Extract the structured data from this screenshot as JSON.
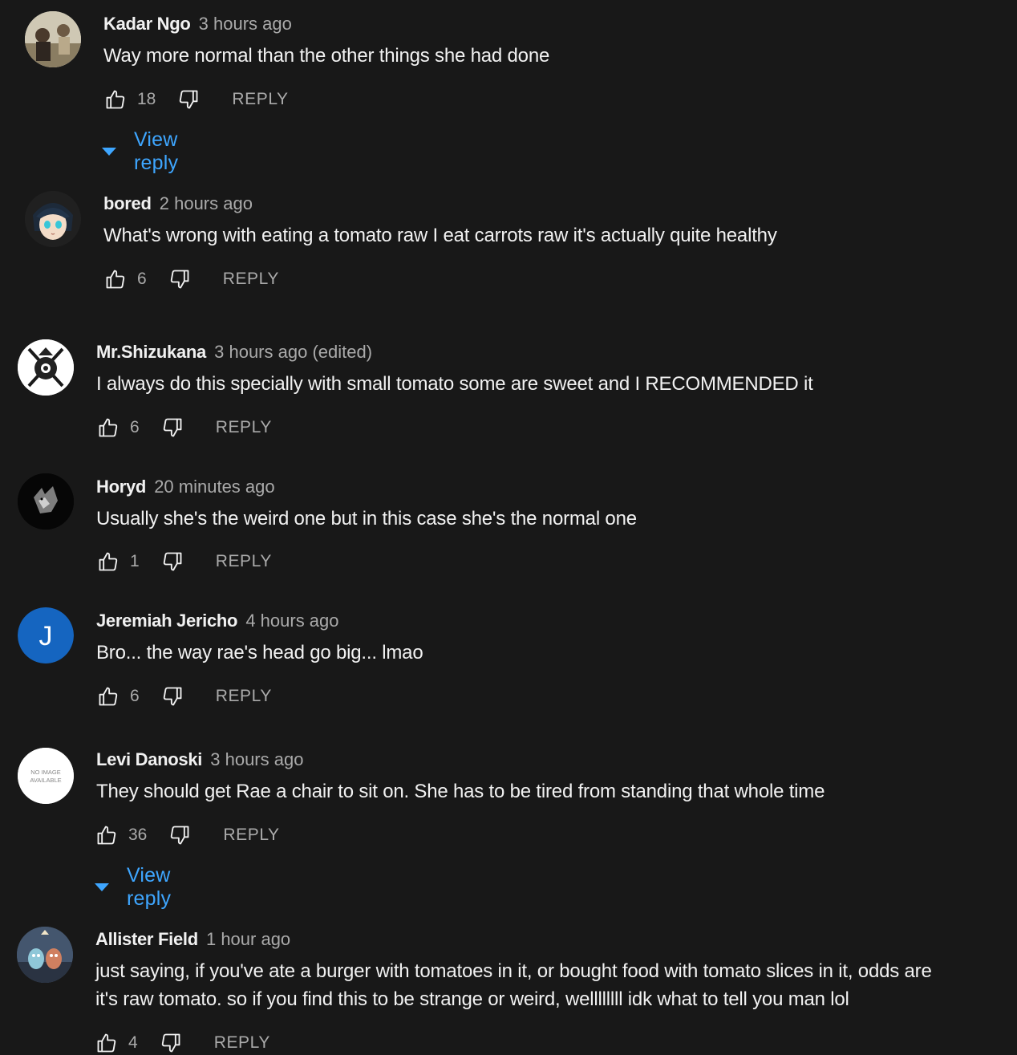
{
  "comments": [
    {
      "author": "Kadar Ngo",
      "time": "3 hours ago",
      "edited": "",
      "text": "Way more normal than the other things she had done",
      "likes": "18",
      "reply_label": "REPLY",
      "view_reply_label": "View reply",
      "avatar_type": "photo-person"
    },
    {
      "author": "bored",
      "time": "2 hours ago",
      "edited": "",
      "text": "What's wrong with eating a tomato raw I eat carrots raw it's actually quite healthy",
      "likes": "6",
      "reply_label": "REPLY",
      "avatar_type": "anime-character"
    },
    {
      "author": "Mr.Shizukana",
      "time": "3 hours ago",
      "edited": "(edited)",
      "text": "I always do this specially with small tomato some are sweet and I RECOMMENDED it",
      "likes": "6",
      "reply_label": "REPLY",
      "avatar_type": "crossed-swords-emblem"
    },
    {
      "author": "Horyd",
      "time": "20 minutes ago",
      "edited": "",
      "text": "Usually she's the weird one but in this case she's the normal one",
      "likes": "1",
      "reply_label": "REPLY",
      "avatar_type": "dark-wolf"
    },
    {
      "author": "Jeremiah Jericho",
      "time": "4 hours ago",
      "edited": "",
      "text": "Bro... the way rae's head go big... lmao",
      "likes": "6",
      "reply_label": "REPLY",
      "avatar_letter": "J",
      "avatar_color": "#1565c0",
      "avatar_type": "letter"
    },
    {
      "author": "Levi Danoski",
      "time": "3 hours ago",
      "edited": "",
      "text": "They should get Rae a chair to sit on. She has to be tired from standing that whole time",
      "likes": "36",
      "reply_label": "REPLY",
      "view_reply_label": "View reply",
      "avatar_placeholder": "NO IMAGE AVAILABLE",
      "avatar_type": "no-image"
    },
    {
      "author": "Allister Field",
      "time": "1 hour ago",
      "edited": "",
      "text": "just saying, if you've ate a burger with tomatoes in it, or bought food with tomato slices in it, odds are it's raw tomato. so if you find this to be strange or weird, wellllllll idk what to tell you man lol",
      "likes": "4",
      "reply_label": "REPLY",
      "avatar_type": "cartoon-characters"
    }
  ],
  "colors": {
    "background": "#181818",
    "text": "#f1f1f1",
    "secondary": "#aaaaaa",
    "link": "#3ea6ff"
  },
  "icons": {
    "like": "thumbs-up-icon",
    "dislike": "thumbs-down-icon",
    "expand": "caret-down-icon"
  }
}
